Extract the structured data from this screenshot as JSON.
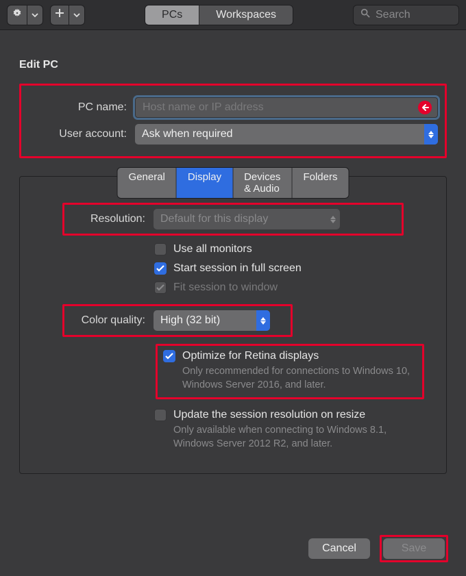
{
  "toolbar": {
    "tabs": {
      "pcs": "PCs",
      "workspaces": "Workspaces"
    },
    "search_placeholder": "Search"
  },
  "page": {
    "title": "Edit PC"
  },
  "form": {
    "pc_name_label": "PC name:",
    "pc_name_placeholder": "Host name or IP address",
    "user_account_label": "User account:",
    "user_account_value": "Ask when required"
  },
  "panel_tabs": {
    "general": "General",
    "display": "Display",
    "devices_audio": "Devices & Audio",
    "folders": "Folders"
  },
  "display": {
    "resolution_label": "Resolution:",
    "resolution_value": "Default for this display",
    "use_all_monitors": "Use all monitors",
    "start_full_screen": "Start session in full screen",
    "fit_to_window": "Fit session to window",
    "color_quality_label": "Color quality:",
    "color_quality_value": "High (32 bit)",
    "optimize_retina": "Optimize for Retina displays",
    "optimize_retina_sub": "Only recommended for connections to Windows 10, Windows Server 2016, and later.",
    "update_on_resize": "Update the session resolution on resize",
    "update_on_resize_sub": "Only available when connecting to Windows 8.1, Windows Server 2012 R2, and later."
  },
  "footer": {
    "cancel": "Cancel",
    "save": "Save"
  }
}
